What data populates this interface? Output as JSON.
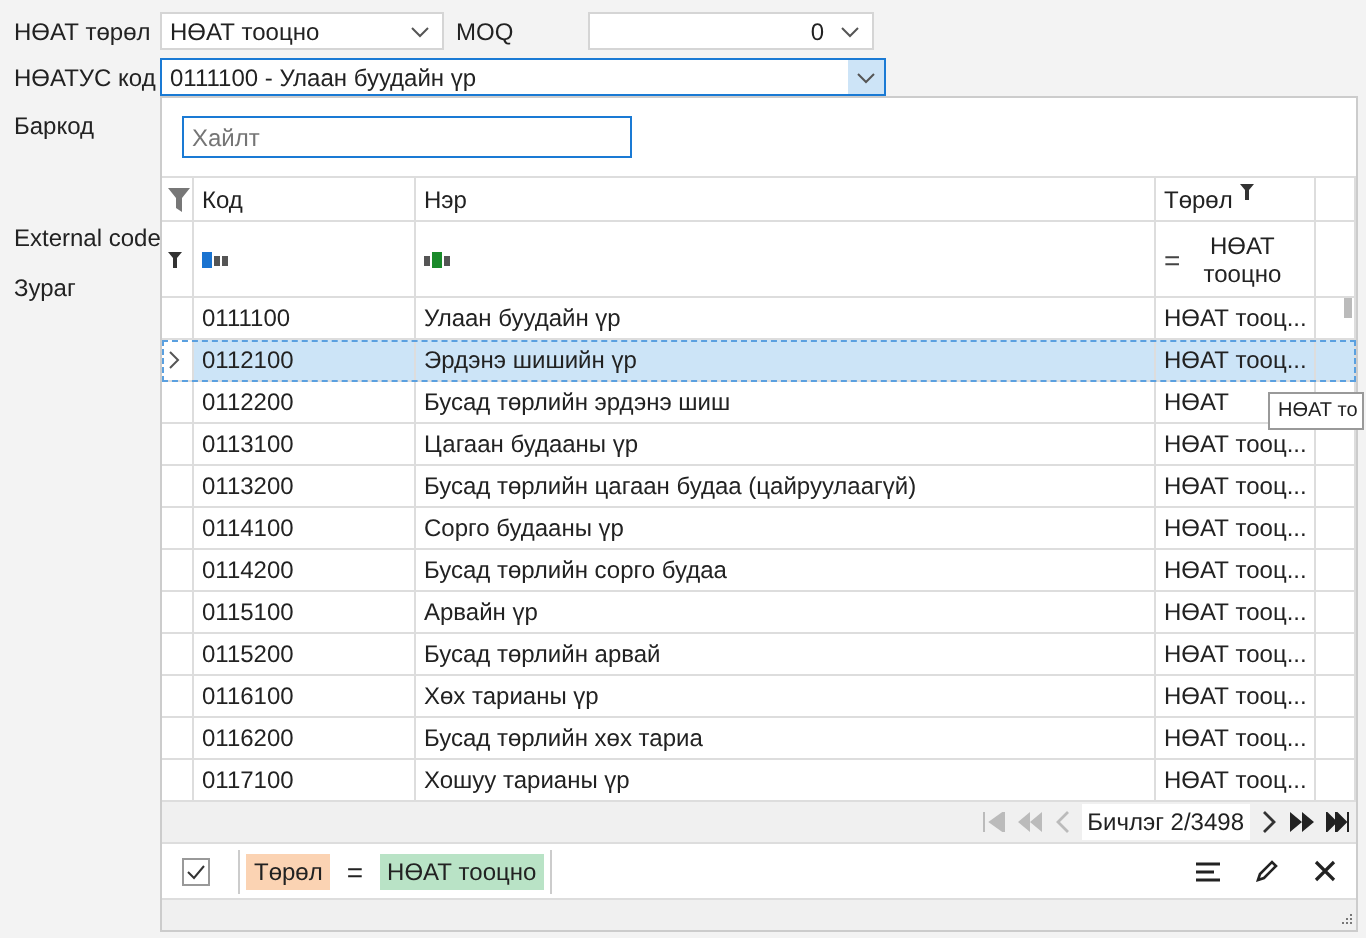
{
  "form": {
    "vat_type": {
      "label": "НӨАТ төрөл",
      "value": "НӨАТ тооцно"
    },
    "moq": {
      "label": "MOQ",
      "value": "0"
    },
    "vat_code": {
      "label": "НӨАТУС код",
      "value": "0111100 - Улаан буудайн үр"
    },
    "labels": [
      "Баркод",
      "External code",
      "Зураг"
    ]
  },
  "popup": {
    "search": {
      "placeholder": "Хайлт"
    },
    "columns": [
      {
        "label": "Код"
      },
      {
        "label": "Нэр"
      },
      {
        "label": "Төрөл"
      }
    ],
    "filter_row": {
      "operator": "=",
      "type_filter": "НӨАТ тооцно"
    },
    "rows": [
      {
        "code": "0111100",
        "name": "Улаан буудайн үр",
        "type": "НӨАТ тооц...",
        "selected": false
      },
      {
        "code": "0112100",
        "name": "Эрдэнэ шишийн үр",
        "type": "НӨАТ тооц...",
        "selected": true
      },
      {
        "code": "0112200",
        "name": "Бусад төрлийн эрдэнэ шиш",
        "type": "НӨАТ",
        "selected": false
      },
      {
        "code": "0113100",
        "name": "Цагаан будааны үр",
        "type": "НӨАТ тооц...",
        "selected": false
      },
      {
        "code": "0113200",
        "name": "Бусад төрлийн цагаан будаа (цайруулаагүй)",
        "type": "НӨАТ тооц...",
        "selected": false
      },
      {
        "code": "0114100",
        "name": "Сорго будааны үр",
        "type": "НӨАТ тооц...",
        "selected": false
      },
      {
        "code": "0114200",
        "name": "Бусад төрлийн сорго будаа",
        "type": "НӨАТ тооц...",
        "selected": false
      },
      {
        "code": "0115100",
        "name": "Арвайн үр",
        "type": "НӨАТ тооц...",
        "selected": false
      },
      {
        "code": "0115200",
        "name": "Бусад төрлийн арвай",
        "type": "НӨАТ тооц...",
        "selected": false
      },
      {
        "code": "0116100",
        "name": "Хөх тарианы үр",
        "type": "НӨАТ тооц...",
        "selected": false
      },
      {
        "code": "0116200",
        "name": "Бусад төрлийн хөх тариа",
        "type": "НӨАТ тооц...",
        "selected": false
      },
      {
        "code": "0117100",
        "name": "Хошуу тарианы үр",
        "type": "НӨАТ тооц...",
        "selected": false
      }
    ],
    "pager": "Бичлэг 2/3498",
    "filter_panel": {
      "checked": true,
      "field": "Төрөл",
      "operator": "=",
      "value": "НӨАТ тооцно"
    },
    "tooltip": "НӨАТ то"
  }
}
